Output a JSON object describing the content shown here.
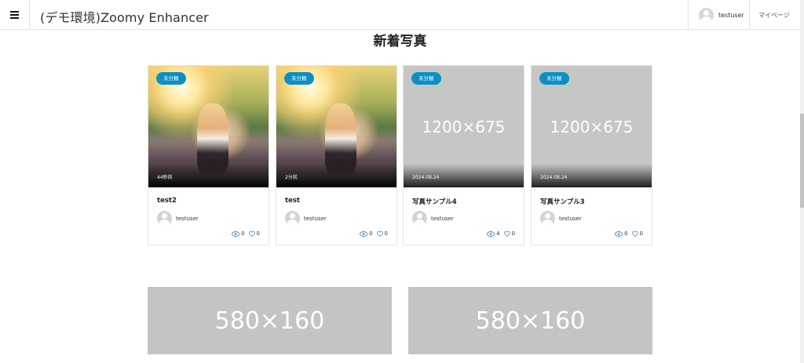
{
  "header": {
    "site_title": "(デモ環境)Zoomy Enhancer",
    "user_name": "testuser",
    "mypage_label": "マイページ"
  },
  "section": {
    "title": "新着写真"
  },
  "cards": [
    {
      "badge": "未分類",
      "date": "44秒前",
      "title": "test2",
      "author": "testuser",
      "views": "0",
      "likes": "0",
      "image": "photo"
    },
    {
      "badge": "未分類",
      "date": "2分前",
      "title": "test",
      "author": "testuser",
      "views": "0",
      "likes": "0",
      "image": "photo"
    },
    {
      "badge": "未分類",
      "date": "2024.08.24",
      "title": "写真サンプル4",
      "author": "testuser",
      "views": "4",
      "likes": "0",
      "image": "placeholder",
      "placeholder_text": "1200×675"
    },
    {
      "badge": "未分類",
      "date": "2024.08.24",
      "title": "写真サンプル3",
      "author": "testuser",
      "views": "0",
      "likes": "0",
      "image": "placeholder",
      "placeholder_text": "1200×675"
    }
  ],
  "banners": [
    {
      "text": "580×160"
    },
    {
      "text": "580×160"
    }
  ],
  "colors": {
    "badge": "#0c8fc6",
    "placeholder": "#c5c7c4",
    "banner": "#c4c4c4",
    "stat_icon": "#3a8fc9"
  },
  "icons": {
    "menu": "hamburger-icon",
    "views": "eye-icon",
    "likes": "heart-icon",
    "avatar": "user-avatar-icon"
  }
}
